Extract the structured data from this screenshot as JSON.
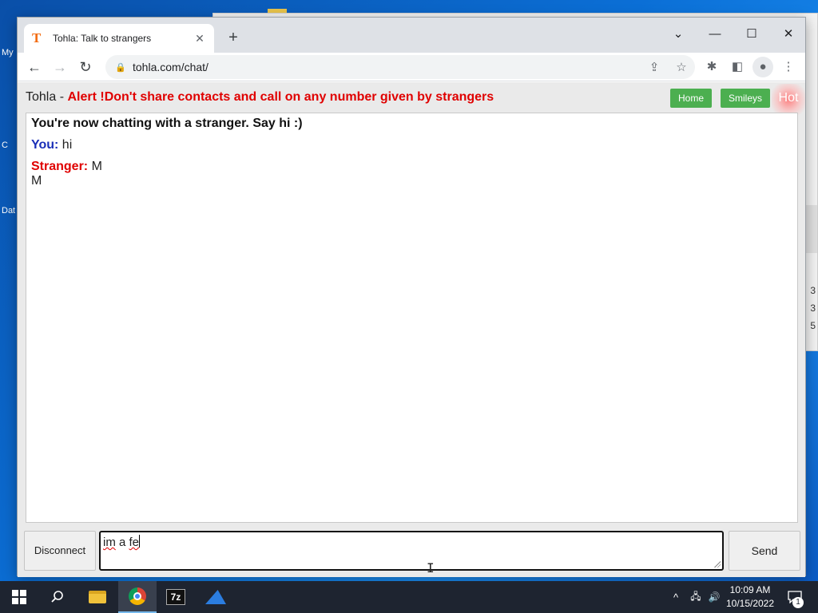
{
  "desktop": {
    "labels": [
      "My",
      "C",
      "Dat"
    ],
    "bg_numbers": [
      "3",
      "3",
      "5"
    ]
  },
  "browser": {
    "tab": {
      "favicon": "T",
      "title": "Tohla: Talk to strangers",
      "close": "✕"
    },
    "new_tab": "+",
    "window": {
      "tab_search": "⌄",
      "minimize": "—",
      "maximize": "☐",
      "close": "✕"
    },
    "nav": {
      "back": "←",
      "forward": "→",
      "reload": "↻"
    },
    "address": {
      "lock": "🔒",
      "url": "tohla.com/chat/",
      "share": "⇪",
      "bookmark": "☆"
    },
    "tools": {
      "extensions": "✱",
      "side_panel": "◧",
      "profile": "●",
      "menu": "⋮"
    }
  },
  "site": {
    "brand": "Tohla - ",
    "alert": "Alert !Don't share contacts and call on any number given by strangers",
    "buttons": {
      "home": "Home",
      "smileys": "Smileys",
      "hot": "Hot"
    }
  },
  "chat": {
    "system_message": "You're now chatting with a stranger. Say hi :)",
    "messages": [
      {
        "sender": "You:",
        "text": " hi"
      },
      {
        "sender": "Stranger:",
        "text": " M",
        "text2": "M"
      }
    ],
    "disconnect_label": "Disconnect",
    "input_value": {
      "word1": "im",
      "middle": " a ",
      "word2": "fe"
    },
    "send_label": "Send"
  },
  "taskbar": {
    "zip_label": "7z",
    "tray": {
      "chevron": "^",
      "network": "🖧",
      "volume": "🔊"
    },
    "time": "10:09 AM",
    "date": "10/15/2022",
    "notifications": "1"
  },
  "colors": {
    "alert": "#e00000",
    "you": "#1a2fb8",
    "stranger": "#e00000",
    "button_green": "#4caf50"
  }
}
